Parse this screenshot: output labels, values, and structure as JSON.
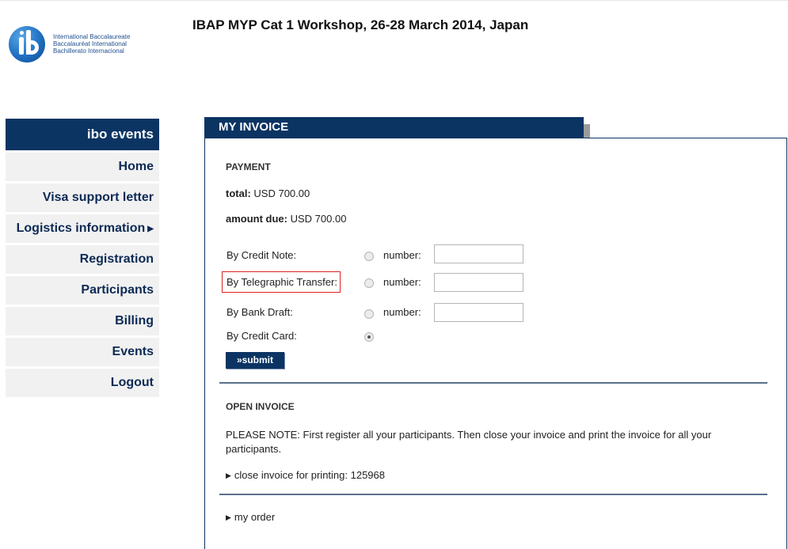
{
  "logo": {
    "lines": [
      "International Baccalaureate",
      "Baccalauréat International",
      "Bachillerato Internacional"
    ]
  },
  "page": {
    "title": "IBAP MYP Cat 1 Workshop, 26-28 March 2014, Japan"
  },
  "sidebar": {
    "header": "ibo events",
    "items": [
      {
        "label": "Home"
      },
      {
        "label": "Visa support letter"
      },
      {
        "label": "Logistics information",
        "submenu_icon": "right-triangle"
      },
      {
        "label": "Registration"
      },
      {
        "label": "Participants"
      },
      {
        "label": "Billing"
      },
      {
        "label": "Events"
      },
      {
        "label": "Logout"
      }
    ]
  },
  "invoice": {
    "title": "MY INVOICE",
    "payment": {
      "heading": "PAYMENT",
      "total_label": "total:",
      "total_value": "USD 700.00",
      "due_label": "amount due:",
      "due_value": "USD 700.00",
      "methods": [
        {
          "label": "By Credit Note:",
          "number_label": "number:",
          "number_value": "",
          "selected": false
        },
        {
          "label": "By Telegraphic Transfer:",
          "number_label": "number:",
          "number_value": "",
          "selected": false,
          "highlighted": true
        },
        {
          "label": "By Bank Draft:",
          "number_label": "number:",
          "number_value": "",
          "selected": false
        },
        {
          "label": "By Credit Card:",
          "selected": true
        }
      ],
      "submit_label": "»submit"
    },
    "open_invoice": {
      "heading": "OPEN INVOICE",
      "note": "PLEASE NOTE: First register all your participants. Then close your invoice and print the invoice for all your participants.",
      "close_link": "close invoice for printing: 125968"
    },
    "my_order_link": "my order"
  },
  "colors": {
    "navy": "#0b3463",
    "sidebar_item_bg": "#f1f1f1",
    "highlight_border": "#dd2222"
  }
}
